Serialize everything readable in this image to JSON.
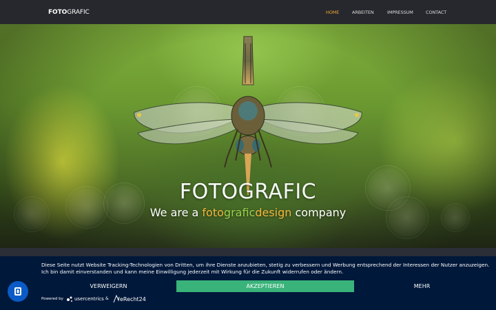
{
  "header": {
    "logo_part1": "FOTO",
    "logo_part2": "GRAFIC"
  },
  "nav": {
    "items": [
      {
        "label": "HOME",
        "active": true
      },
      {
        "label": "ARBEITEN",
        "active": false
      },
      {
        "label": "IMPRESSUM",
        "active": false
      },
      {
        "label": "CONTACT",
        "active": false
      }
    ],
    "active_color": "#f0a630"
  },
  "hero": {
    "title_part1": "FOTO",
    "title_part2": "GRAFIC",
    "subtitle_prefix": "We are a ",
    "subtitle_word1": "foto",
    "subtitle_word2": "grafic",
    "subtitle_word3": "design",
    "subtitle_suffix": " company",
    "accent_orange": "#f3b63c",
    "accent_green": "#9bd04b",
    "image": "dragonfly-macro-photo"
  },
  "cookie": {
    "text": "Diese Seite nutzt Website Tracking-Technologien von Dritten, um ihre Dienste anzubieten, stetig zu verbessern und Werbung entsprechend der Interessen der Nutzer anzuzeigen. Ich bin damit einverstanden und kann meine Einwilligung jederzeit mit Wirkung für die Zukunft widerrufen oder ändern.",
    "deny_label": "VERWEIGERN",
    "accept_label": "AKZEPTIEREN",
    "more_label": "MEHR",
    "powered_by": "Powered by",
    "usercentrics": "usercentrics",
    "ampersand": "&",
    "erecht": "eRecht24",
    "accept_color": "#3ab37a",
    "banner_color": "#00183a"
  },
  "privacy_button": {
    "icon": "fingerprint-shield-icon"
  }
}
